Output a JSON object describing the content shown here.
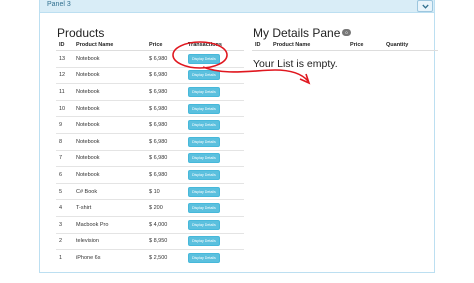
{
  "panel": {
    "title": "Panel 3"
  },
  "products": {
    "title": "Products",
    "columns": {
      "id": "ID",
      "name": "Product Name",
      "price": "Price",
      "transactions": "Transactions"
    },
    "button_label": "Display Details",
    "rows": [
      {
        "id": "13",
        "name": "Notebook",
        "price": "$ 6,980"
      },
      {
        "id": "12",
        "name": "Notebook",
        "price": "$ 6,980"
      },
      {
        "id": "11",
        "name": "Notebook",
        "price": "$ 6,980"
      },
      {
        "id": "10",
        "name": "Notebook",
        "price": "$ 6,980"
      },
      {
        "id": "9",
        "name": "Notebook",
        "price": "$ 6,980"
      },
      {
        "id": "8",
        "name": "Notebook",
        "price": "$ 6,980"
      },
      {
        "id": "7",
        "name": "Notebook",
        "price": "$ 6,980"
      },
      {
        "id": "6",
        "name": "Notebook",
        "price": "$ 6,980"
      },
      {
        "id": "5",
        "name": "C# Book",
        "price": "$ 10"
      },
      {
        "id": "4",
        "name": "T-shirt",
        "price": "$ 200"
      },
      {
        "id": "3",
        "name": "Macbook Pro",
        "price": "$ 4,000"
      },
      {
        "id": "2",
        "name": "television",
        "price": "$ 8,950"
      },
      {
        "id": "1",
        "name": "iPhone 6s",
        "price": "$ 2,500"
      }
    ]
  },
  "details": {
    "title": "My Details Pane",
    "badge": "0",
    "columns": {
      "id": "ID",
      "name": "Product Name",
      "price": "Price",
      "quantity": "Quantity"
    },
    "empty_message": "Your List is empty."
  },
  "colors": {
    "button": "#5bc0de",
    "panel_header": "#d9edf7",
    "annotation": "#e0171f"
  }
}
